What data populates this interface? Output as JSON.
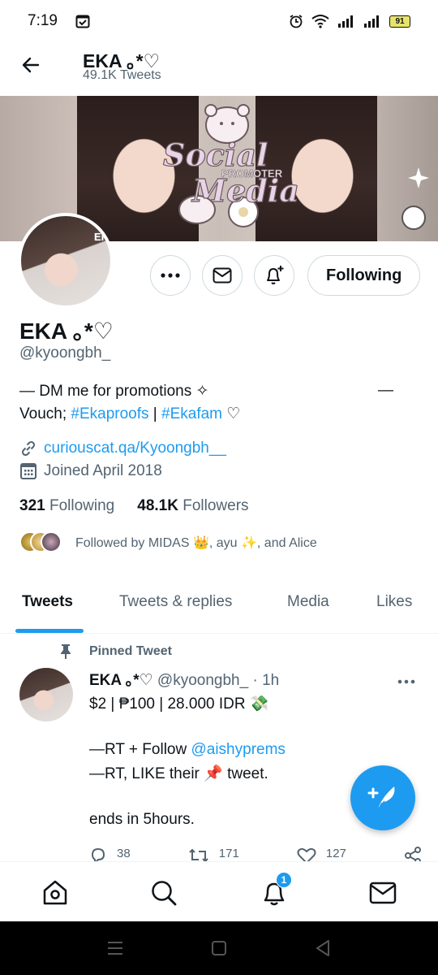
{
  "status_bar": {
    "time": "7:19",
    "battery": "91"
  },
  "header": {
    "name": "EKA ｡*♡",
    "tweet_count": "49.1K Tweets"
  },
  "banner": {
    "text_line1": "Social",
    "text_line2": "PROMOTER",
    "text_line3": "Media"
  },
  "avatar": {
    "tag": "EKA"
  },
  "actions": {
    "following_label": "Following"
  },
  "profile": {
    "name": "EKA ｡*♡",
    "handle": "@kyoongbh_",
    "bio_line1": "— DM me for promotions ✧",
    "bio_dash_right": "—",
    "bio_line2_prefix": "Vouch; ",
    "bio_link1": "#Ekaproofs",
    "bio_sep": " | ",
    "bio_link2": "#Ekafam",
    "bio_suffix": " ♡",
    "website": "curiouscat.qa/Kyoongbh__",
    "joined": "Joined April 2018",
    "following_count": "321",
    "following_label": "Following",
    "followers_count": "48.1K",
    "followers_label": "Followers",
    "followed_by": "Followed by MIDAS 👑, ayu ✨, and Alice"
  },
  "tabs": [
    {
      "label": "Tweets",
      "active": true
    },
    {
      "label": "Tweets & replies",
      "active": false
    },
    {
      "label": "Media",
      "active": false
    },
    {
      "label": "Likes",
      "active": false
    }
  ],
  "tweet": {
    "pinned_label": "Pinned Tweet",
    "name": "EKA ｡*♡",
    "handle": "@kyoongbh_",
    "dot": "·",
    "time": "1h",
    "line1": "$2 | ₱100 | 28.000 IDR 💸",
    "line2_prefix": "—RT + Follow ",
    "line2_mention": "@aishyprems",
    "line3": "—RT, LIKE their 📌 tweet.",
    "line4": "ends in 5hours.",
    "replies": "38",
    "retweets": "171",
    "likes": "127"
  },
  "bottom_nav": {
    "notification_badge": "1"
  },
  "colors": {
    "accent": "#1d9bf0",
    "text": "#0f1419",
    "muted": "#536471",
    "border": "#cfd9de"
  },
  "icons": [
    "back-arrow-icon",
    "alarm-icon",
    "wifi-icon",
    "signal-icon",
    "battery-icon",
    "more-icon",
    "mail-icon",
    "bell-plus-icon",
    "link-icon",
    "calendar-icon",
    "pin-icon",
    "reply-icon",
    "retweet-icon",
    "heart-icon",
    "share-icon",
    "compose-icon",
    "home-icon",
    "search-icon",
    "bell-icon"
  ]
}
